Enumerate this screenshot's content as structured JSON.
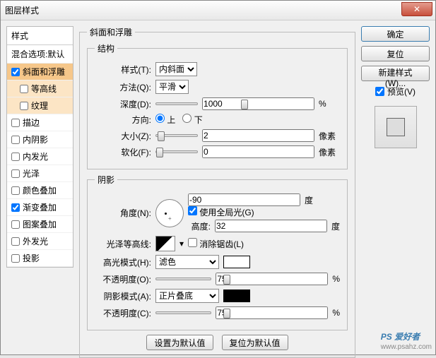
{
  "window": {
    "title": "图层样式"
  },
  "left": {
    "header": "样式",
    "blend": "混合选项:默认",
    "items": [
      {
        "label": "斜面和浮雕",
        "checked": true,
        "selected": true
      },
      {
        "label": "等高线",
        "checked": false,
        "sub": true
      },
      {
        "label": "纹理",
        "checked": false,
        "sub": true
      },
      {
        "label": "描边",
        "checked": false
      },
      {
        "label": "内阴影",
        "checked": false
      },
      {
        "label": "内发光",
        "checked": false
      },
      {
        "label": "光泽",
        "checked": false
      },
      {
        "label": "颜色叠加",
        "checked": false
      },
      {
        "label": "渐变叠加",
        "checked": true
      },
      {
        "label": "图案叠加",
        "checked": false
      },
      {
        "label": "外发光",
        "checked": false
      },
      {
        "label": "投影",
        "checked": false
      }
    ]
  },
  "bevel": {
    "group_title": "斜面和浮雕",
    "structure_title": "结构",
    "style_label": "样式(T):",
    "style_value": "内斜面",
    "method_label": "方法(Q):",
    "method_value": "平滑",
    "depth_label": "深度(D):",
    "depth_value": "1000",
    "depth_unit": "%",
    "direction_label": "方向:",
    "up": "上",
    "down": "下",
    "size_label": "大小(Z):",
    "size_value": "2",
    "size_unit": "像素",
    "soften_label": "软化(F):",
    "soften_value": "0",
    "soften_unit": "像素"
  },
  "shade": {
    "group_title": "阴影",
    "angle_label": "角度(N):",
    "angle_value": "-90",
    "angle_unit": "度",
    "global_label": "使用全局光(G)",
    "global_checked": true,
    "altitude_label": "高度:",
    "altitude_value": "32",
    "altitude_unit": "度",
    "gloss_label": "光泽等高线:",
    "antialias_label": "消除锯齿(L)",
    "highlight_mode_label": "高光模式(H):",
    "highlight_mode_value": "滤色",
    "highlight_opacity_label": "不透明度(O):",
    "highlight_opacity_value": "75",
    "pct": "%",
    "shadow_mode_label": "阴影模式(A):",
    "shadow_mode_value": "正片叠底",
    "shadow_opacity_label": "不透明度(C):",
    "shadow_opacity_value": "75"
  },
  "buttons": {
    "default_set": "设置为默认值",
    "default_reset": "复位为默认值",
    "ok": "确定",
    "cancel": "复位",
    "newstyle": "新建样式(W)...",
    "preview": "预览(V)"
  },
  "watermark": {
    "brand": "PS 爱好者",
    "url": "www.psahz.com"
  }
}
